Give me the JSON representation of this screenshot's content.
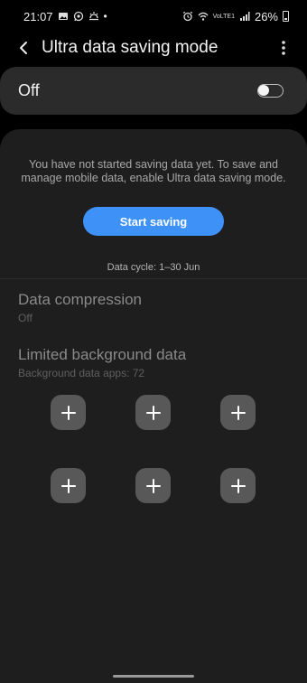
{
  "status_bar": {
    "time": "21:07",
    "battery": "26%",
    "volte_label": "VoLTE1",
    "left_icons": [
      "gallery-icon",
      "whatsapp-icon",
      "weather-icon",
      "dot-icon"
    ],
    "right_icons": [
      "alarm-icon",
      "wifi-icon",
      "volte-icon",
      "signal-icon",
      "battery-icon"
    ]
  },
  "header": {
    "title": "Ultra data saving mode"
  },
  "master_switch": {
    "label": "Off",
    "state": "off"
  },
  "intro": {
    "text": "You have not started saving data yet. To save and manage mobile data, enable Ultra data saving mode.",
    "button_label": "Start saving"
  },
  "cycle": {
    "text": "Data cycle: 1–30 Jun"
  },
  "settings": [
    {
      "title": "Data compression",
      "subtitle": "Off"
    },
    {
      "title": "Limited background data",
      "subtitle": "Background data apps: 72"
    }
  ],
  "app_slots": [
    "add",
    "add",
    "add",
    "add",
    "add",
    "add"
  ],
  "colors": {
    "accent": "#3e91f7",
    "background": "#000000",
    "card": "#1e1e1e",
    "switch_card": "#2b2b2b",
    "add_button": "#585858"
  }
}
